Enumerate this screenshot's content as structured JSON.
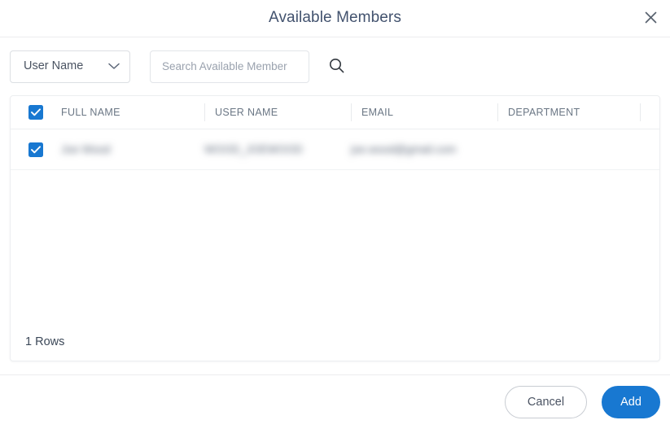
{
  "dialog": {
    "title": "Available Members",
    "close_icon": "close-icon"
  },
  "toolbar": {
    "filter_select": {
      "value": "User Name",
      "chevron_icon": "chevron-down-icon"
    },
    "search": {
      "value": "",
      "placeholder": "Search Available Member"
    },
    "search_button_icon": "search-icon"
  },
  "table": {
    "select_all_checked": true,
    "columns": [
      {
        "label": "FULL NAME"
      },
      {
        "label": "USER NAME"
      },
      {
        "label": "EMAIL"
      },
      {
        "label": "DEPARTMENT"
      },
      {
        "label": ""
      }
    ],
    "rows": [
      {
        "checked": true,
        "full_name": "Joe Wood",
        "user_name": "WOOD_JOEWOOD",
        "email": "joe.wood@gmail.com",
        "department": "",
        "extra": ""
      }
    ],
    "rows_count_label": "1 Rows"
  },
  "footer": {
    "cancel_label": "Cancel",
    "add_label": "Add"
  },
  "colors": {
    "accent": "#1878d1",
    "title": "#42526e",
    "header_text": "#6b7785",
    "border": "#eceef0"
  }
}
